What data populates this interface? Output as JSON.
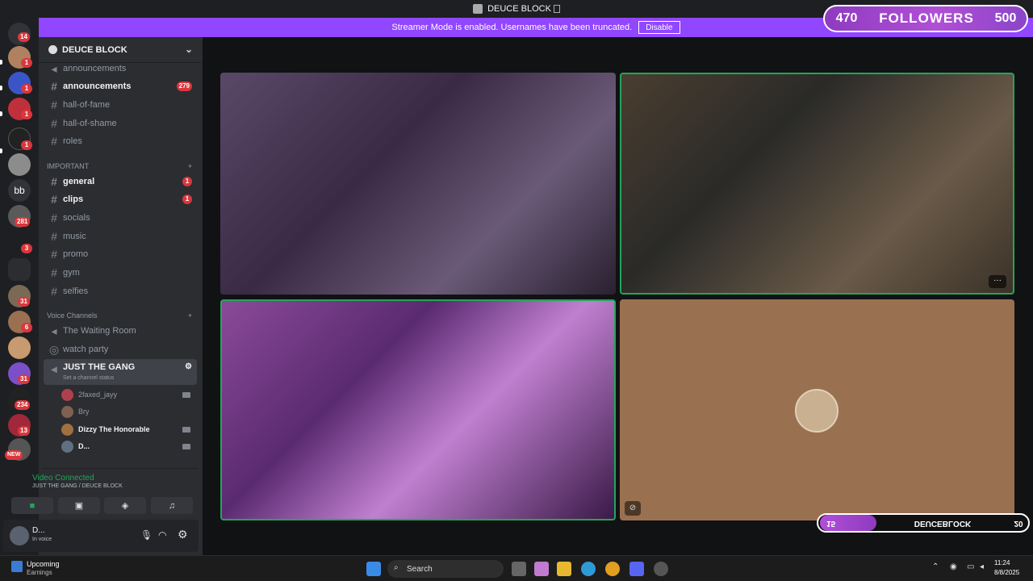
{
  "window": {
    "title": "DEUCE BLOCK"
  },
  "banner": {
    "text": "Streamer Mode is enabled. Usernames have been truncated.",
    "button": "Disable"
  },
  "guilds": {
    "badges": [
      "14",
      "1",
      "1",
      "1",
      "1",
      "281",
      "3",
      "31",
      "6",
      "31",
      "234",
      "13"
    ],
    "bb_label": "bb",
    "new_badge": "NEW"
  },
  "server": {
    "name": "DEUCE BLOCK"
  },
  "channels": [
    {
      "name": "announcements",
      "unread": false,
      "count": ""
    },
    {
      "name": "announcements",
      "unread": true,
      "count": "279"
    },
    {
      "name": "hall-of-fame",
      "unread": false,
      "count": ""
    },
    {
      "name": "hall-of-shame",
      "unread": false,
      "count": ""
    },
    {
      "name": "roles",
      "unread": false,
      "count": ""
    }
  ],
  "important": {
    "label": "IMPORTANT",
    "channels": [
      {
        "name": "general",
        "unread": true,
        "count": "1"
      },
      {
        "name": "clips",
        "unread": true,
        "count": "1"
      },
      {
        "name": "socials",
        "unread": false,
        "count": ""
      },
      {
        "name": "music",
        "unread": false,
        "count": ""
      },
      {
        "name": "promo",
        "unread": false,
        "count": ""
      },
      {
        "name": "gym",
        "unread": false,
        "count": ""
      },
      {
        "name": "selfies",
        "unread": false,
        "count": ""
      }
    ]
  },
  "voice": {
    "label": "Voice Channels",
    "channels": [
      "The Waiting Room",
      "watch party",
      "JUST THE GANG"
    ],
    "status_placeholder": "Set a channel status",
    "members": [
      "2faxed_jayy",
      "Bry",
      "Dizzy The Honorable",
      "D..."
    ]
  },
  "connection": {
    "title": "Video Connected",
    "sub": "JUST THE GANG / DEUCE BLOCK"
  },
  "user": {
    "name": "D...",
    "status": "In voice"
  },
  "overlay": {
    "left": "470",
    "label": "FOLLOWERS",
    "right": "500"
  },
  "overlay2": {
    "left": "15",
    "label": "DEUCEBLOCK",
    "right": "20"
  },
  "taskbar": {
    "widget_title": "Upcoming",
    "widget_sub": "Earnings",
    "search": "Search",
    "time": "11:24",
    "date": "8/8/2025"
  },
  "colors": {
    "accent": "#9146ff",
    "green": "#23a55a",
    "red": "#da373c"
  }
}
